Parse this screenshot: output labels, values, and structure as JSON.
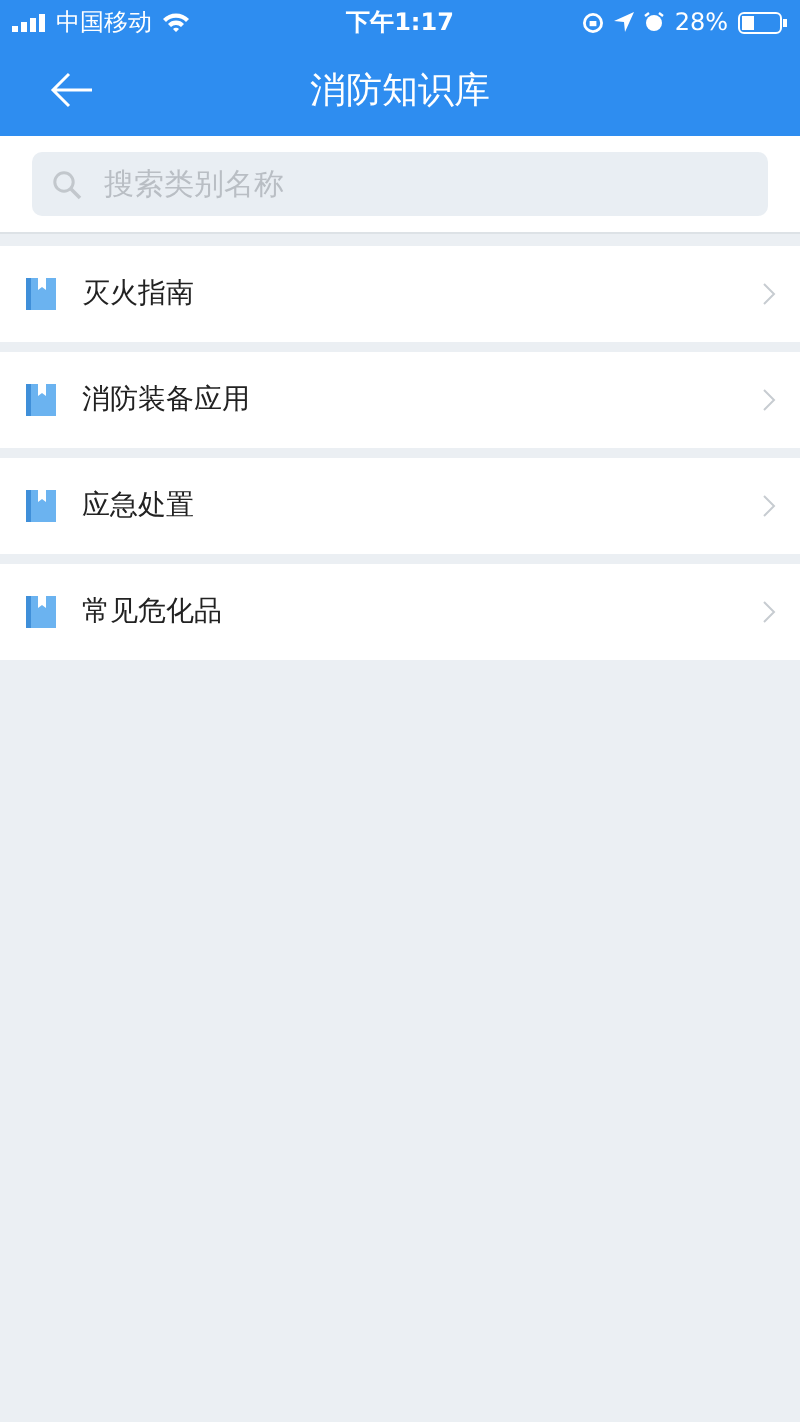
{
  "status_bar": {
    "carrier": "中国移动",
    "time": "下午1:17",
    "battery": "28%"
  },
  "header": {
    "title": "消防知识库"
  },
  "search": {
    "placeholder": "搜索类别名称"
  },
  "categories": [
    {
      "label": "灭火指南"
    },
    {
      "label": "消防装备应用"
    },
    {
      "label": "应急处置"
    },
    {
      "label": "常见危化品"
    }
  ]
}
